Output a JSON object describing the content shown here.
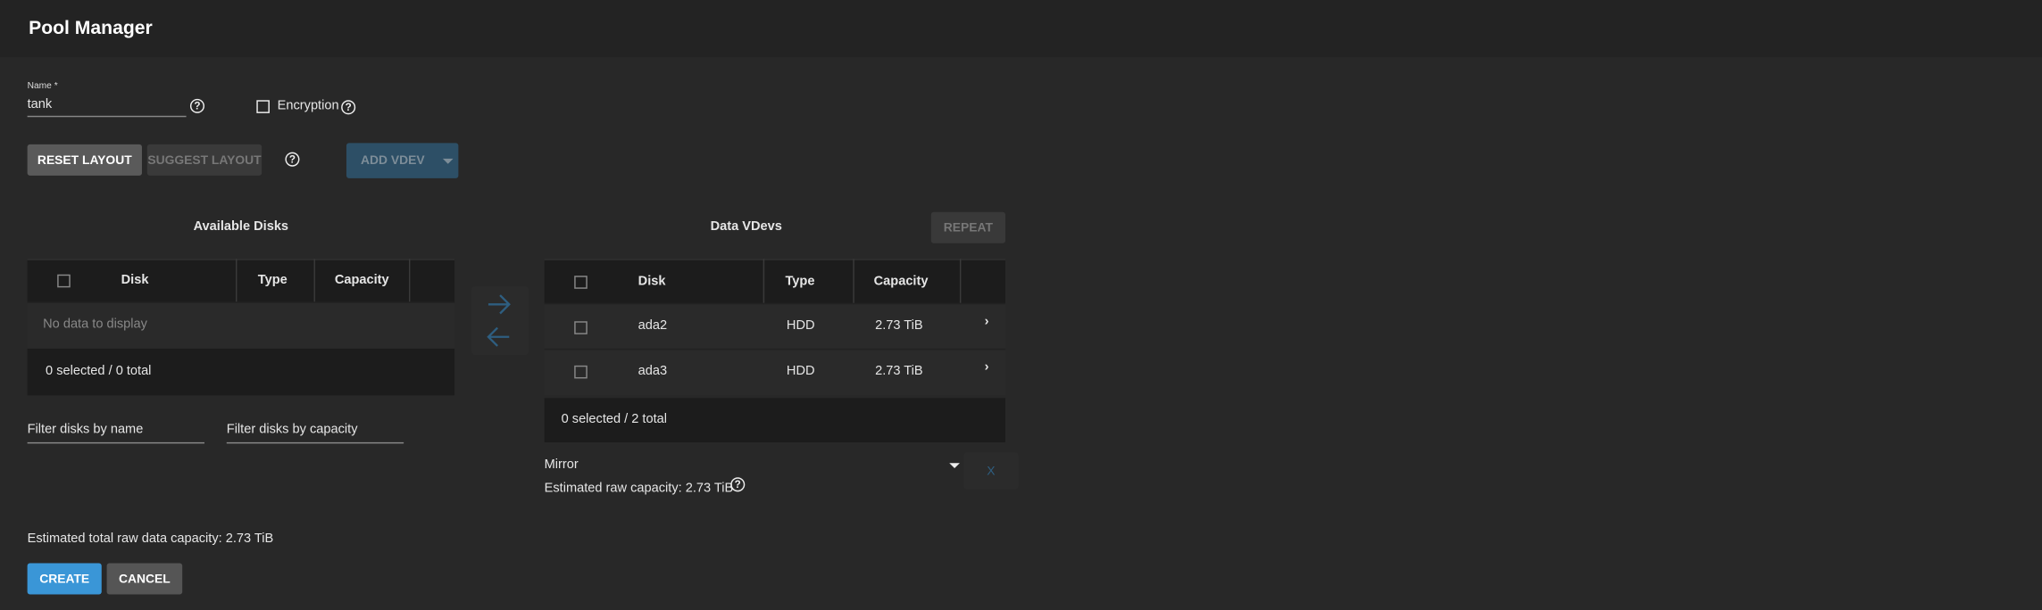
{
  "header": {
    "title": "Pool Manager"
  },
  "form": {
    "name_label": "Name *",
    "name_value": "tank",
    "encryption_label": "Encryption",
    "help_glyph": "?"
  },
  "toolbar": {
    "reset_layout": "RESET LAYOUT",
    "suggest_layout": "SUGGEST LAYOUT",
    "add_vdev": "ADD VDEV"
  },
  "available": {
    "title": "Available Disks",
    "columns": [
      "Disk",
      "Type",
      "Capacity"
    ],
    "empty": "No data to display",
    "footer": "0 selected / 0 total",
    "filter_name": "Filter disks by name",
    "filter_capacity": "Filter disks by capacity"
  },
  "vdevs": {
    "title": "Data VDevs",
    "repeat": "REPEAT",
    "columns": [
      "Disk",
      "Type",
      "Capacity"
    ],
    "rows": [
      {
        "disk": "ada2",
        "type": "HDD",
        "capacity": "2.73 TiB"
      },
      {
        "disk": "ada3",
        "type": "HDD",
        "capacity": "2.73 TiB"
      }
    ],
    "footer": "0 selected / 2 total",
    "layout": "Mirror",
    "estimated": "Estimated raw capacity: 2.73 TiB",
    "remove": "X"
  },
  "summary": {
    "estimated_total": "Estimated total raw data capacity: 2.73 TiB"
  },
  "actions": {
    "create": "CREATE",
    "cancel": "CANCEL"
  },
  "colors": {
    "accent": "#3a96d7",
    "arrow": "#2e5e80"
  }
}
